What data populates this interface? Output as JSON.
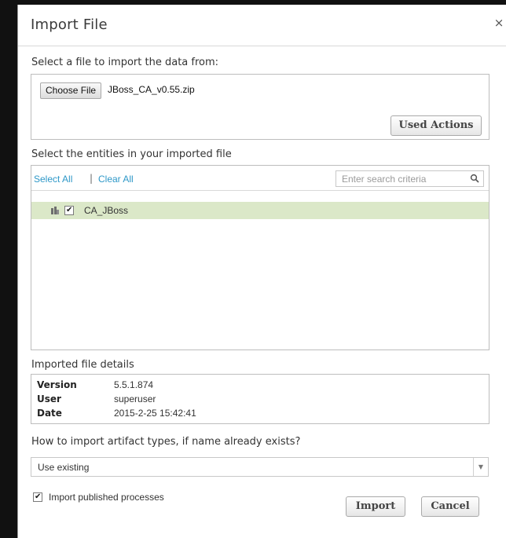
{
  "dialog": {
    "title": "Import File",
    "close_glyph": "×"
  },
  "file_section": {
    "label": "Select a file to import the data from:",
    "choose_button": "Choose File",
    "file_name": "JBoss_CA_v0.55.zip",
    "used_actions_button": "Used Actions"
  },
  "entities_section": {
    "label": "Select the entities in your imported file",
    "select_all": "Select All",
    "separator": "|",
    "clear_all": "Clear All",
    "search_placeholder": "Enter search criteria",
    "search_icon": "magnifier-icon",
    "items": [
      {
        "label": "CA_JBoss",
        "checked": true,
        "icon": "folder-tree-icon",
        "highlight_color": "#dbe8c8"
      }
    ]
  },
  "details_section": {
    "label": "Imported file details",
    "rows": [
      {
        "key": "Version",
        "value": "5.5.1.874"
      },
      {
        "key": "User",
        "value": "superuser"
      },
      {
        "key": "Date",
        "value": "2015-2-25 15:42:41"
      }
    ]
  },
  "artifact_section": {
    "label": "How to import artifact types, if name already exists?",
    "selected_option": "Use existing"
  },
  "publish": {
    "label": "Import published processes",
    "checked": true
  },
  "actions": {
    "import_button": "Import",
    "cancel_button": "Cancel"
  },
  "colors": {
    "link": "#2e98c8",
    "highlight": "#dbe8c8"
  }
}
